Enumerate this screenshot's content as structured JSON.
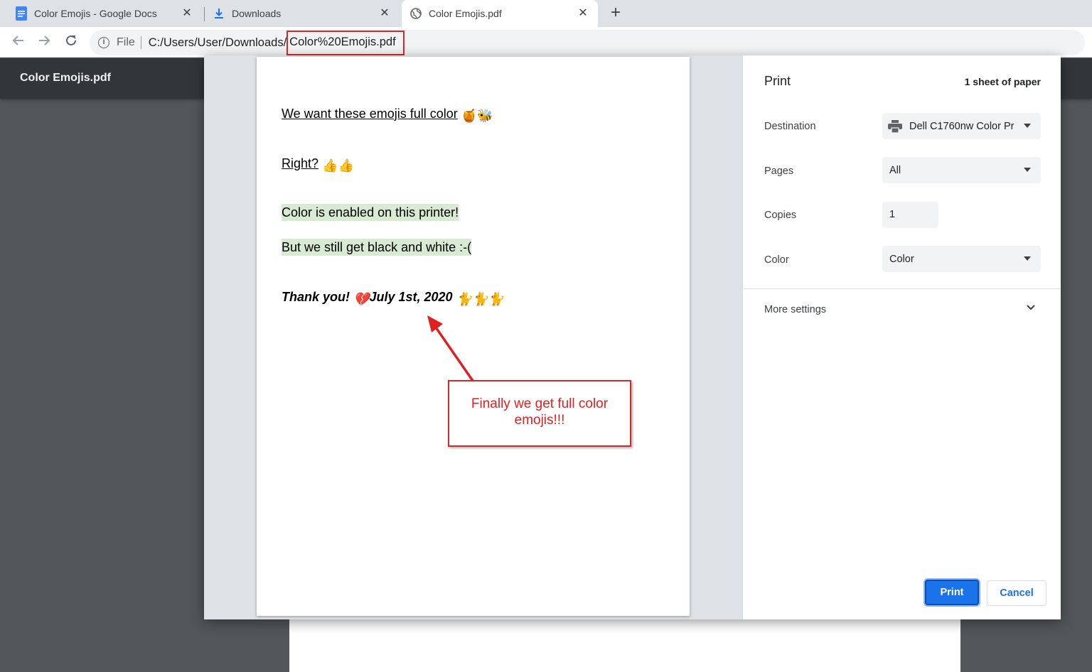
{
  "tabs": [
    {
      "title": "Color Emojis - Google Docs",
      "icon": "google-docs-icon"
    },
    {
      "title": "Downloads",
      "icon": "download-icon"
    },
    {
      "title": "Color Emojis.pdf",
      "icon": "globe-icon"
    }
  ],
  "omnibox": {
    "scheme": "File",
    "path": "C:/Users/User/Downloads/",
    "file": "Color%20Emojis.pdf"
  },
  "pdf_viewer": {
    "title": "Color Emojis.pdf"
  },
  "document": {
    "line1": "We want these emojis full color",
    "line1_emojis": "🍯🐝",
    "line2": "Right?",
    "line2_emojis": "👍👍",
    "line3": "Color is enabled on this printer!",
    "line4": "But we still get black and white :-(",
    "line5_a": "Thank you!",
    "line5_heart": "💔",
    "line5_b": "July 1st, 2020",
    "line5_emojis": "🐈🐈🐈"
  },
  "callout": {
    "text": "Finally we get full color emojis!!!"
  },
  "print_settings": {
    "title": "Print",
    "sheets": "1 sheet of paper",
    "destination_label": "Destination",
    "destination_value": "Dell C1760nw Color Pr",
    "pages_label": "Pages",
    "pages_value": "All",
    "copies_label": "Copies",
    "copies_value": "1",
    "color_label": "Color",
    "color_value": "Color",
    "more_settings": "More settings",
    "print_button": "Print",
    "cancel_button": "Cancel"
  },
  "colors": {
    "accent": "#1a73e8",
    "annotation_red": "#d62828",
    "highlight": "#d9ead3"
  }
}
